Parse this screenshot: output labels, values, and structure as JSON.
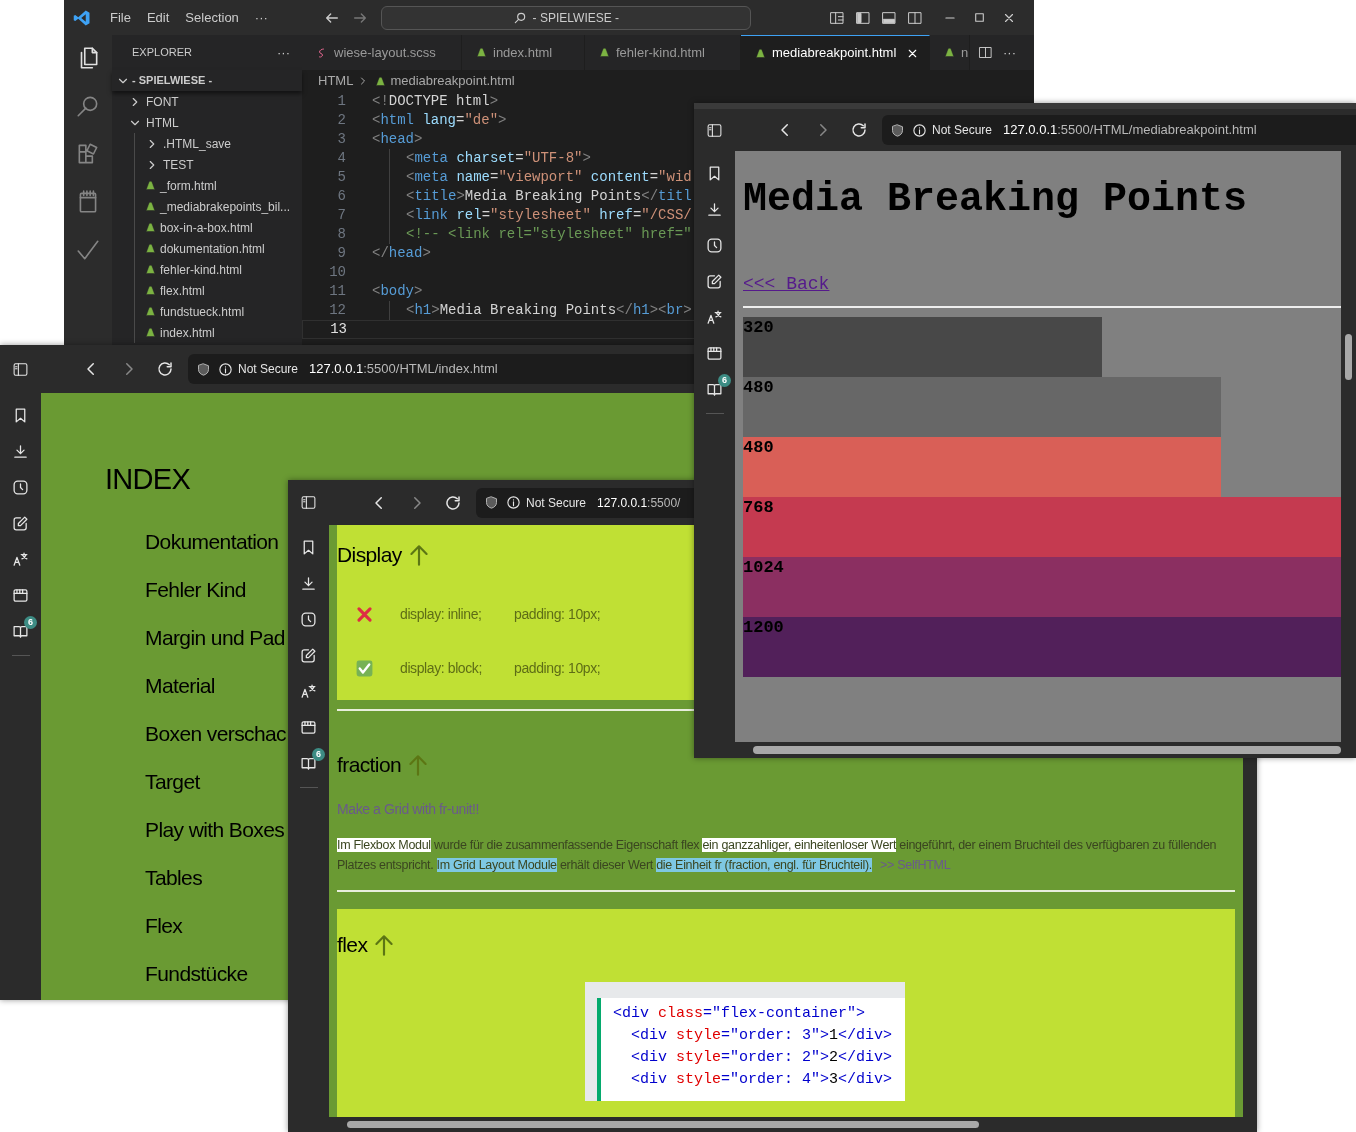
{
  "vscode": {
    "menu": [
      "File",
      "Edit",
      "Selection",
      "···"
    ],
    "command_center": "- SPIELWIESE -",
    "tabs": [
      {
        "label": "wiese-layout.scss",
        "kind": "scss",
        "selected": false
      },
      {
        "label": "index.html",
        "kind": "html",
        "selected": false
      },
      {
        "label": "fehler-kind.html",
        "kind": "html",
        "selected": false
      },
      {
        "label": "mediabreakpoint.html",
        "kind": "html",
        "selected": true
      },
      {
        "label": "n",
        "kind": "html",
        "selected": false
      }
    ],
    "explorer": {
      "title": "EXPLORER",
      "more": "···",
      "root": "- SPIELWIESE -",
      "tree": [
        {
          "label": "FONT",
          "kind": "folder",
          "expanded": false
        },
        {
          "label": "HTML",
          "kind": "folder",
          "expanded": true,
          "children": [
            {
              "label": ".HTML_save",
              "kind": "folder",
              "expanded": false
            },
            {
              "label": "TEST",
              "kind": "folder",
              "expanded": false
            },
            {
              "label": "_form.html",
              "kind": "file"
            },
            {
              "label": "_mediabrakepoints_bil...",
              "kind": "file"
            },
            {
              "label": "box-in-a-box.html",
              "kind": "file"
            },
            {
              "label": "dokumentation.html",
              "kind": "file"
            },
            {
              "label": "fehler-kind.html",
              "kind": "file"
            },
            {
              "label": "flex.html",
              "kind": "file"
            },
            {
              "label": "fundstueck.html",
              "kind": "file"
            },
            {
              "label": "index.html",
              "kind": "file"
            }
          ]
        }
      ]
    },
    "breadcrumb": [
      "HTML",
      "mediabreakpoint.html"
    ],
    "lines": [
      {
        "number": "1",
        "indented": false,
        "selected": false,
        "tokens": [
          {
            "kind": "punct",
            "text": "<!"
          },
          {
            "kind": "text",
            "text": "DOCTYPE html"
          },
          {
            "kind": "punct",
            "text": ">"
          }
        ]
      },
      {
        "number": "2",
        "indented": false,
        "selected": false,
        "tokens": [
          {
            "kind": "punct",
            "text": "<"
          },
          {
            "kind": "tag",
            "text": "html"
          },
          {
            "kind": "attr",
            "text": " lang"
          },
          {
            "kind": "text",
            "text": "="
          },
          {
            "kind": "string",
            "text": "\"de\""
          },
          {
            "kind": "punct",
            "text": ">"
          }
        ]
      },
      {
        "number": "3",
        "indented": false,
        "selected": false,
        "tokens": [
          {
            "kind": "punct",
            "text": "<"
          },
          {
            "kind": "tag",
            "text": "head"
          },
          {
            "kind": "punct",
            "text": ">"
          }
        ]
      },
      {
        "number": "4",
        "indented": true,
        "selected": false,
        "tokens": [
          {
            "kind": "punct",
            "text": "<"
          },
          {
            "kind": "tag",
            "text": "meta"
          },
          {
            "kind": "attr",
            "text": " charset"
          },
          {
            "kind": "text",
            "text": "="
          },
          {
            "kind": "string",
            "text": "\"UTF-8\""
          },
          {
            "kind": "punct",
            "text": ">"
          }
        ]
      },
      {
        "number": "5",
        "indented": true,
        "selected": false,
        "tokens": [
          {
            "kind": "punct",
            "text": "<"
          },
          {
            "kind": "tag",
            "text": "meta"
          },
          {
            "kind": "attr",
            "text": " name"
          },
          {
            "kind": "text",
            "text": "="
          },
          {
            "kind": "string",
            "text": "\"viewport\""
          },
          {
            "kind": "attr",
            "text": " content"
          },
          {
            "kind": "text",
            "text": "="
          },
          {
            "kind": "string",
            "text": "\"wid"
          }
        ]
      },
      {
        "number": "6",
        "indented": true,
        "selected": false,
        "tokens": [
          {
            "kind": "punct",
            "text": "<"
          },
          {
            "kind": "tag",
            "text": "title"
          },
          {
            "kind": "punct",
            "text": ">"
          },
          {
            "kind": "text",
            "text": "Media Breaking Points"
          },
          {
            "kind": "punct",
            "text": "</"
          },
          {
            "kind": "tag",
            "text": "titl"
          }
        ]
      },
      {
        "number": "7",
        "indented": true,
        "selected": false,
        "tokens": [
          {
            "kind": "punct",
            "text": "<"
          },
          {
            "kind": "tag",
            "text": "link"
          },
          {
            "kind": "attr",
            "text": " rel"
          },
          {
            "kind": "text",
            "text": "="
          },
          {
            "kind": "string",
            "text": "\"stylesheet\""
          },
          {
            "kind": "attr",
            "text": " href"
          },
          {
            "kind": "text",
            "text": "="
          },
          {
            "kind": "string",
            "text": "\"/CSS/"
          }
        ]
      },
      {
        "number": "8",
        "indented": true,
        "selected": false,
        "tokens": [
          {
            "kind": "comment",
            "text": "<!-- <link rel=\"stylesheet\" href=\""
          }
        ]
      },
      {
        "number": "9",
        "indented": false,
        "selected": false,
        "tokens": [
          {
            "kind": "punct",
            "text": "</"
          },
          {
            "kind": "tag",
            "text": "head"
          },
          {
            "kind": "punct",
            "text": ">"
          }
        ]
      },
      {
        "number": "10",
        "selected": false
      },
      {
        "number": "11",
        "indented": false,
        "selected": false,
        "tokens": [
          {
            "kind": "punct",
            "text": "<"
          },
          {
            "kind": "tag",
            "text": "body"
          },
          {
            "kind": "punct",
            "text": ">"
          }
        ]
      },
      {
        "number": "12",
        "indented": true,
        "selected": false,
        "tokens": [
          {
            "kind": "punct",
            "text": "<"
          },
          {
            "kind": "tag",
            "text": "h1"
          },
          {
            "kind": "punct",
            "text": ">"
          },
          {
            "kind": "text",
            "text": "Media Breaking Points"
          },
          {
            "kind": "punct",
            "text": "</"
          },
          {
            "kind": "tag",
            "text": "h1"
          },
          {
            "kind": "punct",
            "text": "><"
          },
          {
            "kind": "tag",
            "text": "br"
          },
          {
            "kind": "punct",
            "text": ">"
          }
        ]
      },
      {
        "number": "13",
        "selected": true
      }
    ]
  },
  "browser_index": {
    "security": "Not Secure",
    "url_host": "127.0.0.1",
    "url_path": ":5500/HTML/index.html",
    "badge": "6",
    "heading": "INDEX",
    "links": [
      "Dokumentation",
      "Fehler Kind",
      "Margin und Pad",
      "Material",
      "Boxen verschac",
      "Target",
      "Play with Boxes",
      "Tables",
      "Flex",
      "Fundstücke"
    ]
  },
  "browser_grid": {
    "security": "Not Secure",
    "url_host": "127.0.0.1",
    "url_path": ":5500/",
    "badge": "6",
    "display": {
      "heading": "Display",
      "rows": [
        {
          "correct": false,
          "property": "display: inline;",
          "padding": "padding: 10px;"
        },
        {
          "correct": true,
          "property": "display: block;",
          "padding": "padding: 10px;"
        }
      ]
    },
    "fraction": {
      "heading": "fraction",
      "subtitle": "Make a Grid with fr-unit!!",
      "paragraph": [
        {
          "text": "Im Flexbox Modul",
          "color": "#ffffff"
        },
        {
          "text": " wurde für die zusammenfassende Eigenschaft flex "
        },
        {
          "text": "ein ganzzahliger, einheitenloser Wert",
          "color": "#ffffff"
        },
        {
          "text": " eingeführt, der einem Bruchteil des verfügbaren zu füllenden Platzes entspricht. "
        },
        {
          "text": "Im Grid Layout Module",
          "color": "#7ec8e3"
        },
        {
          "text": " erhält dieser Wert "
        },
        {
          "text": "die Einheit fr (fraction, engl. für Bruchteil).",
          "color": "#7ec8e3"
        }
      ],
      "link": ">> SelfHTML"
    },
    "flex": {
      "heading": "flex",
      "code": [
        {
          "indented": false,
          "tokens": [
            {
              "kind": "tag",
              "text": "<div"
            },
            {
              "kind": "attr",
              "text": " class"
            },
            {
              "kind": "tag",
              "text": "="
            },
            {
              "kind": "string",
              "text": "\"flex-container\""
            },
            {
              "kind": "tag",
              "text": ">"
            }
          ]
        },
        {
          "indented": true,
          "tokens": [
            {
              "kind": "tag",
              "text": "<div"
            },
            {
              "kind": "attr",
              "text": " style"
            },
            {
              "kind": "tag",
              "text": "="
            },
            {
              "kind": "string",
              "text": "\"order: 3\""
            },
            {
              "kind": "tag",
              "text": ">"
            },
            {
              "kind": "text",
              "text": "1"
            },
            {
              "kind": "tag",
              "text": "</div>"
            }
          ]
        },
        {
          "indented": true,
          "tokens": [
            {
              "kind": "tag",
              "text": "<div"
            },
            {
              "kind": "attr",
              "text": " style"
            },
            {
              "kind": "tag",
              "text": "="
            },
            {
              "kind": "string",
              "text": "\"order: 2\""
            },
            {
              "kind": "tag",
              "text": ">"
            },
            {
              "kind": "text",
              "text": "2"
            },
            {
              "kind": "tag",
              "text": "</div>"
            }
          ]
        },
        {
          "indented": true,
          "tokens": [
            {
              "kind": "tag",
              "text": "<div"
            },
            {
              "kind": "attr",
              "text": " style"
            },
            {
              "kind": "tag",
              "text": "="
            },
            {
              "kind": "string",
              "text": "\"order: 4\""
            },
            {
              "kind": "tag",
              "text": ">"
            },
            {
              "kind": "text",
              "text": "3"
            },
            {
              "kind": "tag",
              "text": "</div>"
            }
          ]
        }
      ]
    }
  },
  "browser_breakpoints": {
    "security": "Not Secure",
    "url_host": "127.0.0.1",
    "url_path": ":5500/HTML/mediabreakpoint.html",
    "badge": "6",
    "heading": "Media Breaking Points",
    "back_link": "<<< Back",
    "bars": [
      {
        "label": "320",
        "level": 0.6,
        "color": "#484848"
      },
      {
        "label": "480",
        "level": 0.8,
        "color": "#676767"
      },
      {
        "label": "480",
        "level": 0.8,
        "color": "#d95f57"
      },
      {
        "label": "768",
        "level": 1,
        "color": "#c53a50"
      },
      {
        "label": "1024",
        "level": 1,
        "color": "#8b2f61"
      },
      {
        "label": "1200",
        "level": 1,
        "color": "#52205a"
      }
    ]
  }
}
